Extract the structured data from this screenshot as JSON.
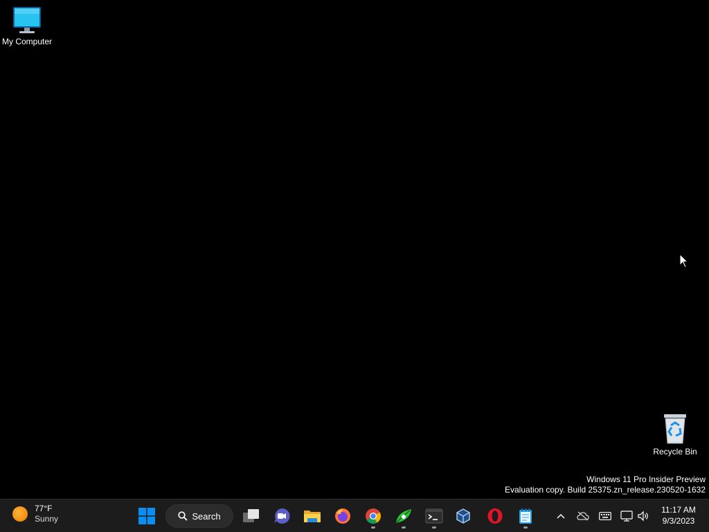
{
  "desktop": {
    "icons": [
      {
        "label": "My Computer",
        "icon": "computer-monitor-icon"
      },
      {
        "label": "Recycle Bin",
        "icon": "recycle-bin-icon"
      }
    ],
    "watermark": {
      "line1": "Windows 11 Pro Insider Preview",
      "line2": "Evaluation copy. Build 25375.zn_release.230520-1632"
    }
  },
  "taskbar": {
    "weather": {
      "temperature": "77°F",
      "condition": "Sunny"
    },
    "search_label": "Search",
    "apps": [
      {
        "name": "task-view",
        "icon": "task-view-icon",
        "running": false
      },
      {
        "name": "teams-chat",
        "icon": "teams-chat-icon",
        "running": false
      },
      {
        "name": "file-explorer",
        "icon": "folder-icon",
        "running": false
      },
      {
        "name": "firefox",
        "icon": "firefox-icon",
        "running": false
      },
      {
        "name": "chrome",
        "icon": "chrome-icon",
        "running": true
      },
      {
        "name": "green-app",
        "icon": "leaf-app-icon",
        "running": true
      },
      {
        "name": "terminal",
        "icon": "terminal-icon",
        "running": true
      },
      {
        "name": "virtualbox",
        "icon": "virtualbox-icon",
        "running": false
      },
      {
        "name": "opera",
        "icon": "opera-icon",
        "running": false
      },
      {
        "name": "notepad",
        "icon": "notepad-icon",
        "running": true
      }
    ],
    "clock": {
      "time": "11:17 AM",
      "date": "9/3/2023"
    }
  },
  "colors": {
    "desktop_bg": "#000000",
    "taskbar_bg": "#1c1c1c",
    "windows_blue": "#0a8ff0"
  }
}
